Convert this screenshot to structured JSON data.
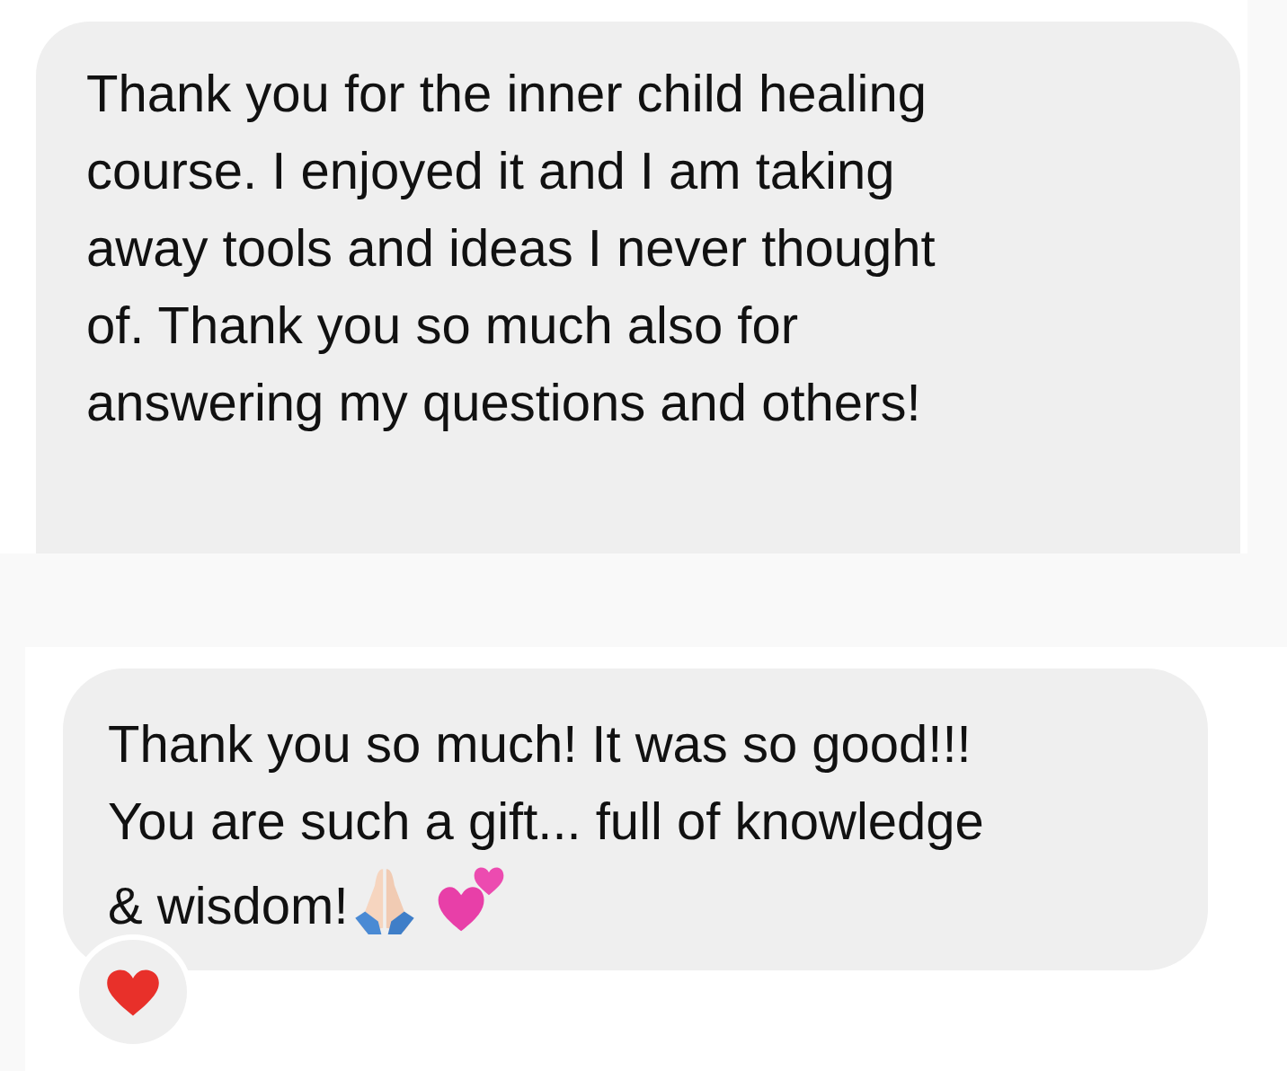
{
  "messages": [
    {
      "text": "Thank you for the inner child healing\ncourse. I enjoyed it and I am taking\naway tools and ideas I never thought\nof. Thank you so much also for\nanswering my questions and others!",
      "trailing_emoji": false,
      "reacted": false
    },
    {
      "text": "Thank you so much! It was so good!!!\nYou are such a gift... full of knowledge\n& wisdom!",
      "trailing_emoji": true,
      "reacted": true
    }
  ]
}
